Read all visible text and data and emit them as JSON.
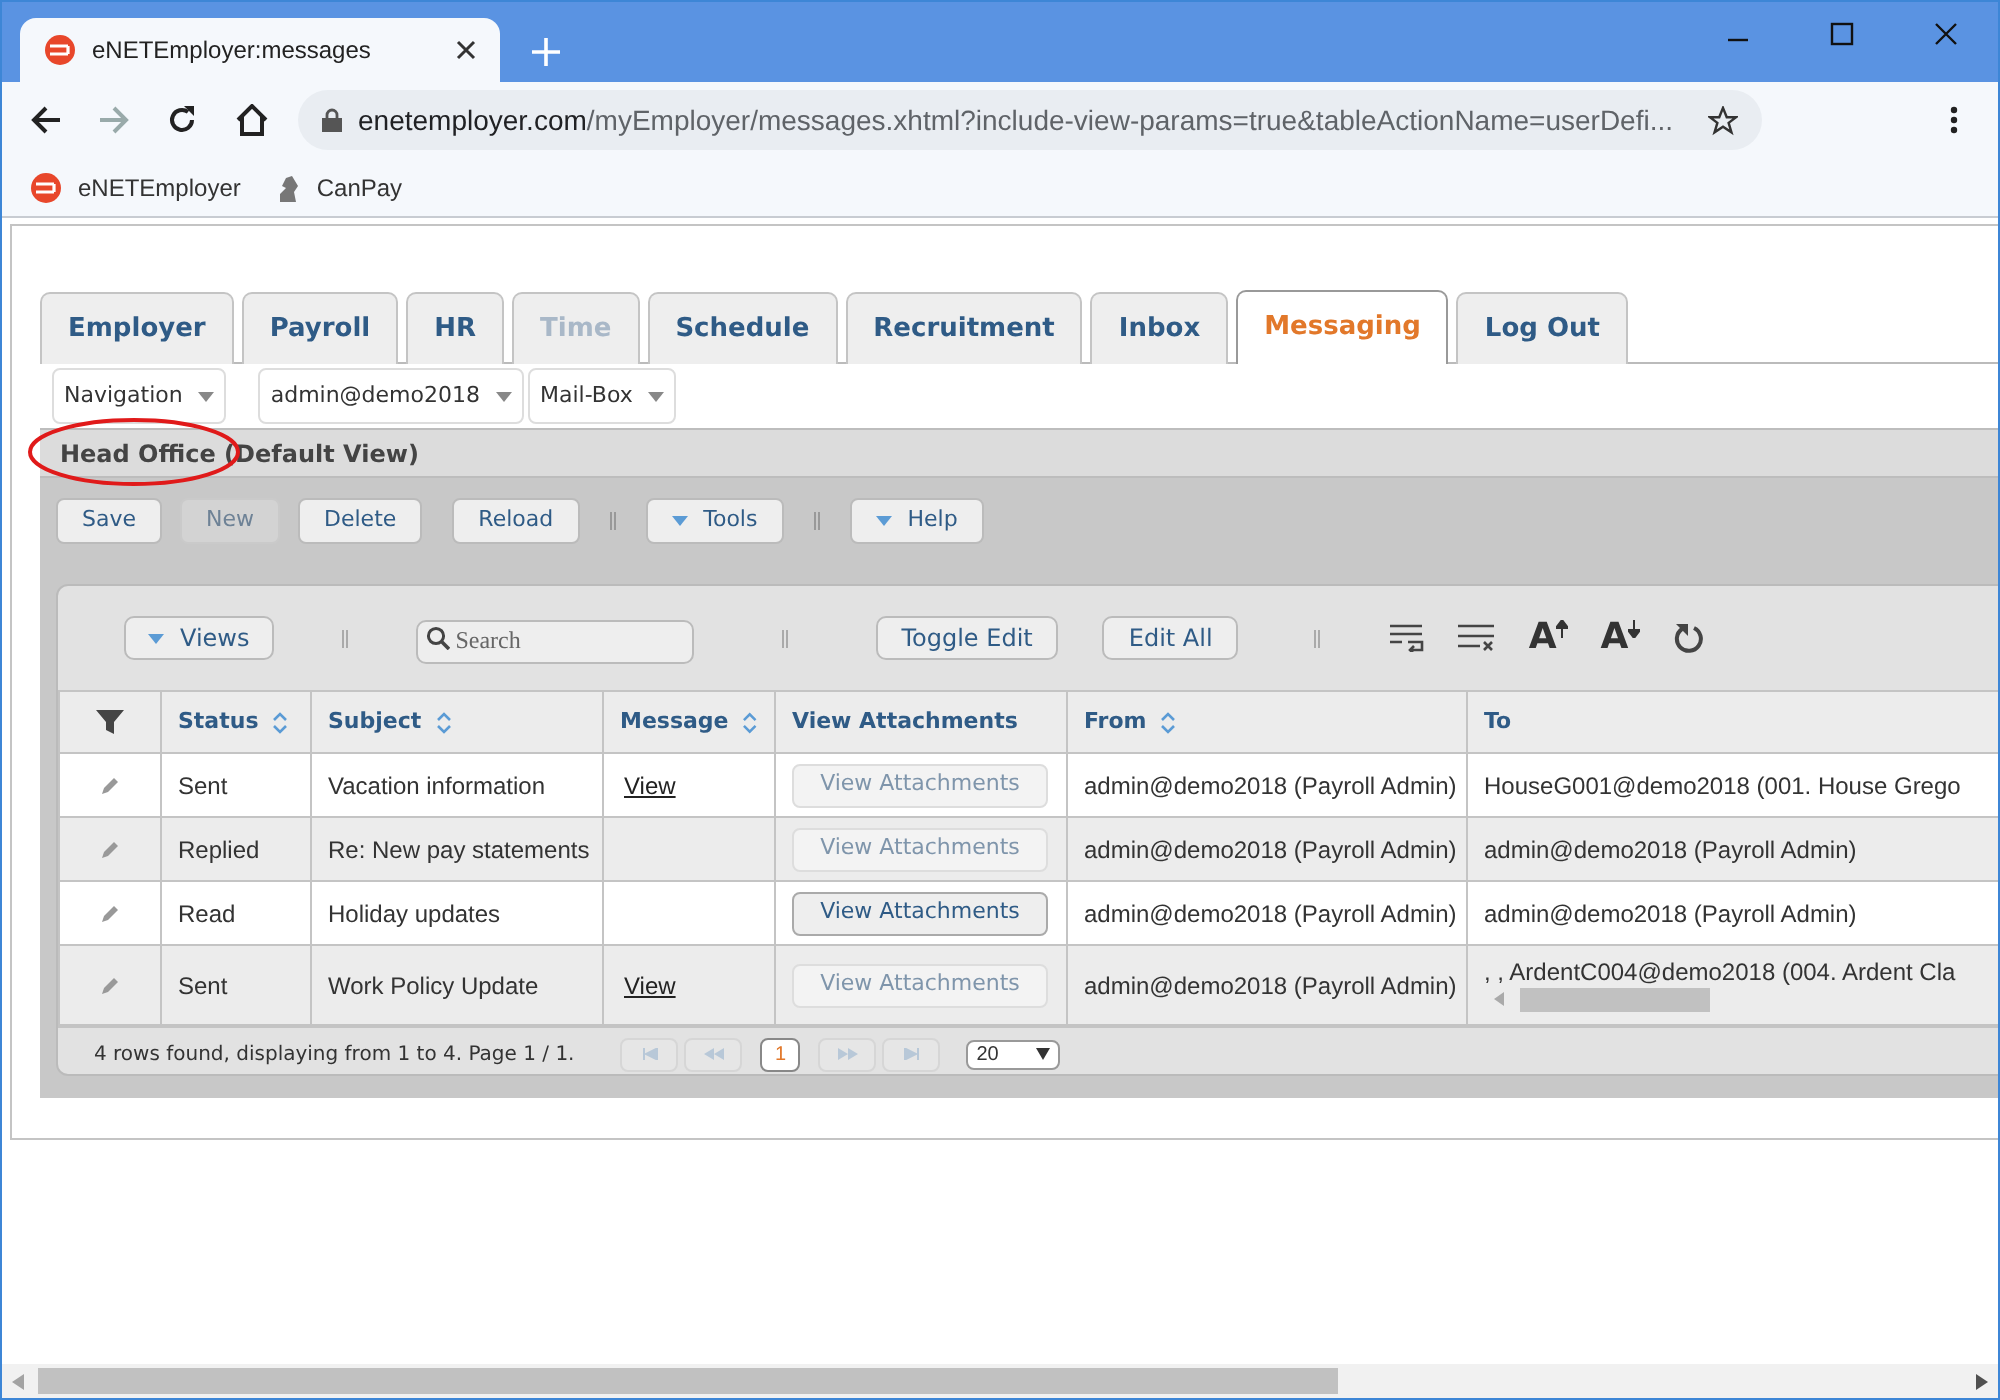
{
  "browser": {
    "tab_title": "eNETEmployer:messages",
    "url_host": "enetemployer.com",
    "url_path": "/myEmployer/messages.xhtml?include-view-params=true&tableActionName=userDefi...",
    "bookmarks": [
      {
        "label": "eNETEmployer",
        "kind": "logo"
      },
      {
        "label": "CanPay",
        "kind": "figure"
      }
    ]
  },
  "tabs": [
    {
      "label": "Employer",
      "selected": false,
      "disabled": false
    },
    {
      "label": "Payroll",
      "selected": false,
      "disabled": false
    },
    {
      "label": "HR",
      "selected": false,
      "disabled": false
    },
    {
      "label": "Time",
      "selected": false,
      "disabled": true
    },
    {
      "label": "Schedule",
      "selected": false,
      "disabled": false
    },
    {
      "label": "Recruitment",
      "selected": false,
      "disabled": false
    },
    {
      "label": "Inbox",
      "selected": false,
      "disabled": false
    },
    {
      "label": "Messaging",
      "selected": true,
      "disabled": false
    },
    {
      "label": "Log Out",
      "selected": false,
      "disabled": false
    }
  ],
  "dropdowns": [
    "Navigation",
    "admin@demo2018",
    "Mail-Box"
  ],
  "view_title": "Head Office (Default View)",
  "toolbar": [
    {
      "label": "Save",
      "kind": "button",
      "disabled": false
    },
    {
      "label": "New",
      "kind": "button",
      "disabled": true
    },
    {
      "label": "Delete",
      "kind": "button",
      "disabled": false
    },
    {
      "label": "Reload",
      "kind": "button",
      "disabled": false
    },
    {
      "label": "Tools",
      "kind": "menu",
      "disabled": false
    },
    {
      "label": "Help",
      "kind": "menu",
      "disabled": false
    }
  ],
  "table_toolbar": {
    "views": "Views",
    "search": {
      "placeholder": "Search"
    },
    "buttons": [
      "Toggle Edit",
      "Edit All"
    ],
    "tools": [
      {
        "kind": "wrap"
      },
      {
        "kind": "unwrap"
      },
      {
        "kind": "font_up",
        "text": "A"
      },
      {
        "kind": "font_down",
        "text": "A"
      },
      {
        "kind": "reset"
      }
    ]
  },
  "columns": [
    {
      "label": "Status",
      "sortable": true
    },
    {
      "label": "Subject",
      "sortable": true
    },
    {
      "label": "Message",
      "sortable": true
    },
    {
      "label": "View Attachments",
      "sortable": false
    },
    {
      "label": "From",
      "sortable": true
    },
    {
      "label": "To",
      "sortable": false
    }
  ],
  "rows": [
    {
      "status": "Sent",
      "subject": "Vacation information",
      "message": "View",
      "attachments": {
        "label": "View Attachments",
        "disabled": true
      },
      "from": "admin@demo2018 (Payroll Admin)",
      "to": "HouseG001@demo2018 (001. House Grego",
      "to_scrollable": false
    },
    {
      "status": "Replied",
      "subject": "Re: New pay statements",
      "attachments": {
        "label": "View Attachments",
        "disabled": true
      },
      "from": "admin@demo2018 (Payroll Admin)",
      "to": "admin@demo2018 (Payroll Admin)",
      "to_scrollable": false
    },
    {
      "status": "Read",
      "subject": "Holiday updates",
      "attachments": {
        "label": "View Attachments",
        "disabled": false
      },
      "from": "admin@demo2018 (Payroll Admin)",
      "to": "admin@demo2018 (Payroll Admin)",
      "to_scrollable": false
    },
    {
      "status": "Sent",
      "subject": "Work Policy Update",
      "message": "View",
      "attachments": {
        "label": "View Attachments",
        "disabled": true
      },
      "from": "admin@demo2018 (Payroll Admin)",
      "to": ", , ArdentC004@demo2018 (004. Ardent Cla",
      "to_scrollable": true
    }
  ],
  "footer": {
    "summary": "4 rows found, displaying from 1 to 4. Page 1 / 1.",
    "pager": [
      {
        "kind": "first",
        "disabled": true
      },
      {
        "kind": "prev",
        "disabled": true
      },
      {
        "kind": "page",
        "label": "1",
        "selected": true
      },
      {
        "kind": "next",
        "disabled": true
      },
      {
        "kind": "last",
        "disabled": true
      }
    ],
    "page_size": "20"
  }
}
